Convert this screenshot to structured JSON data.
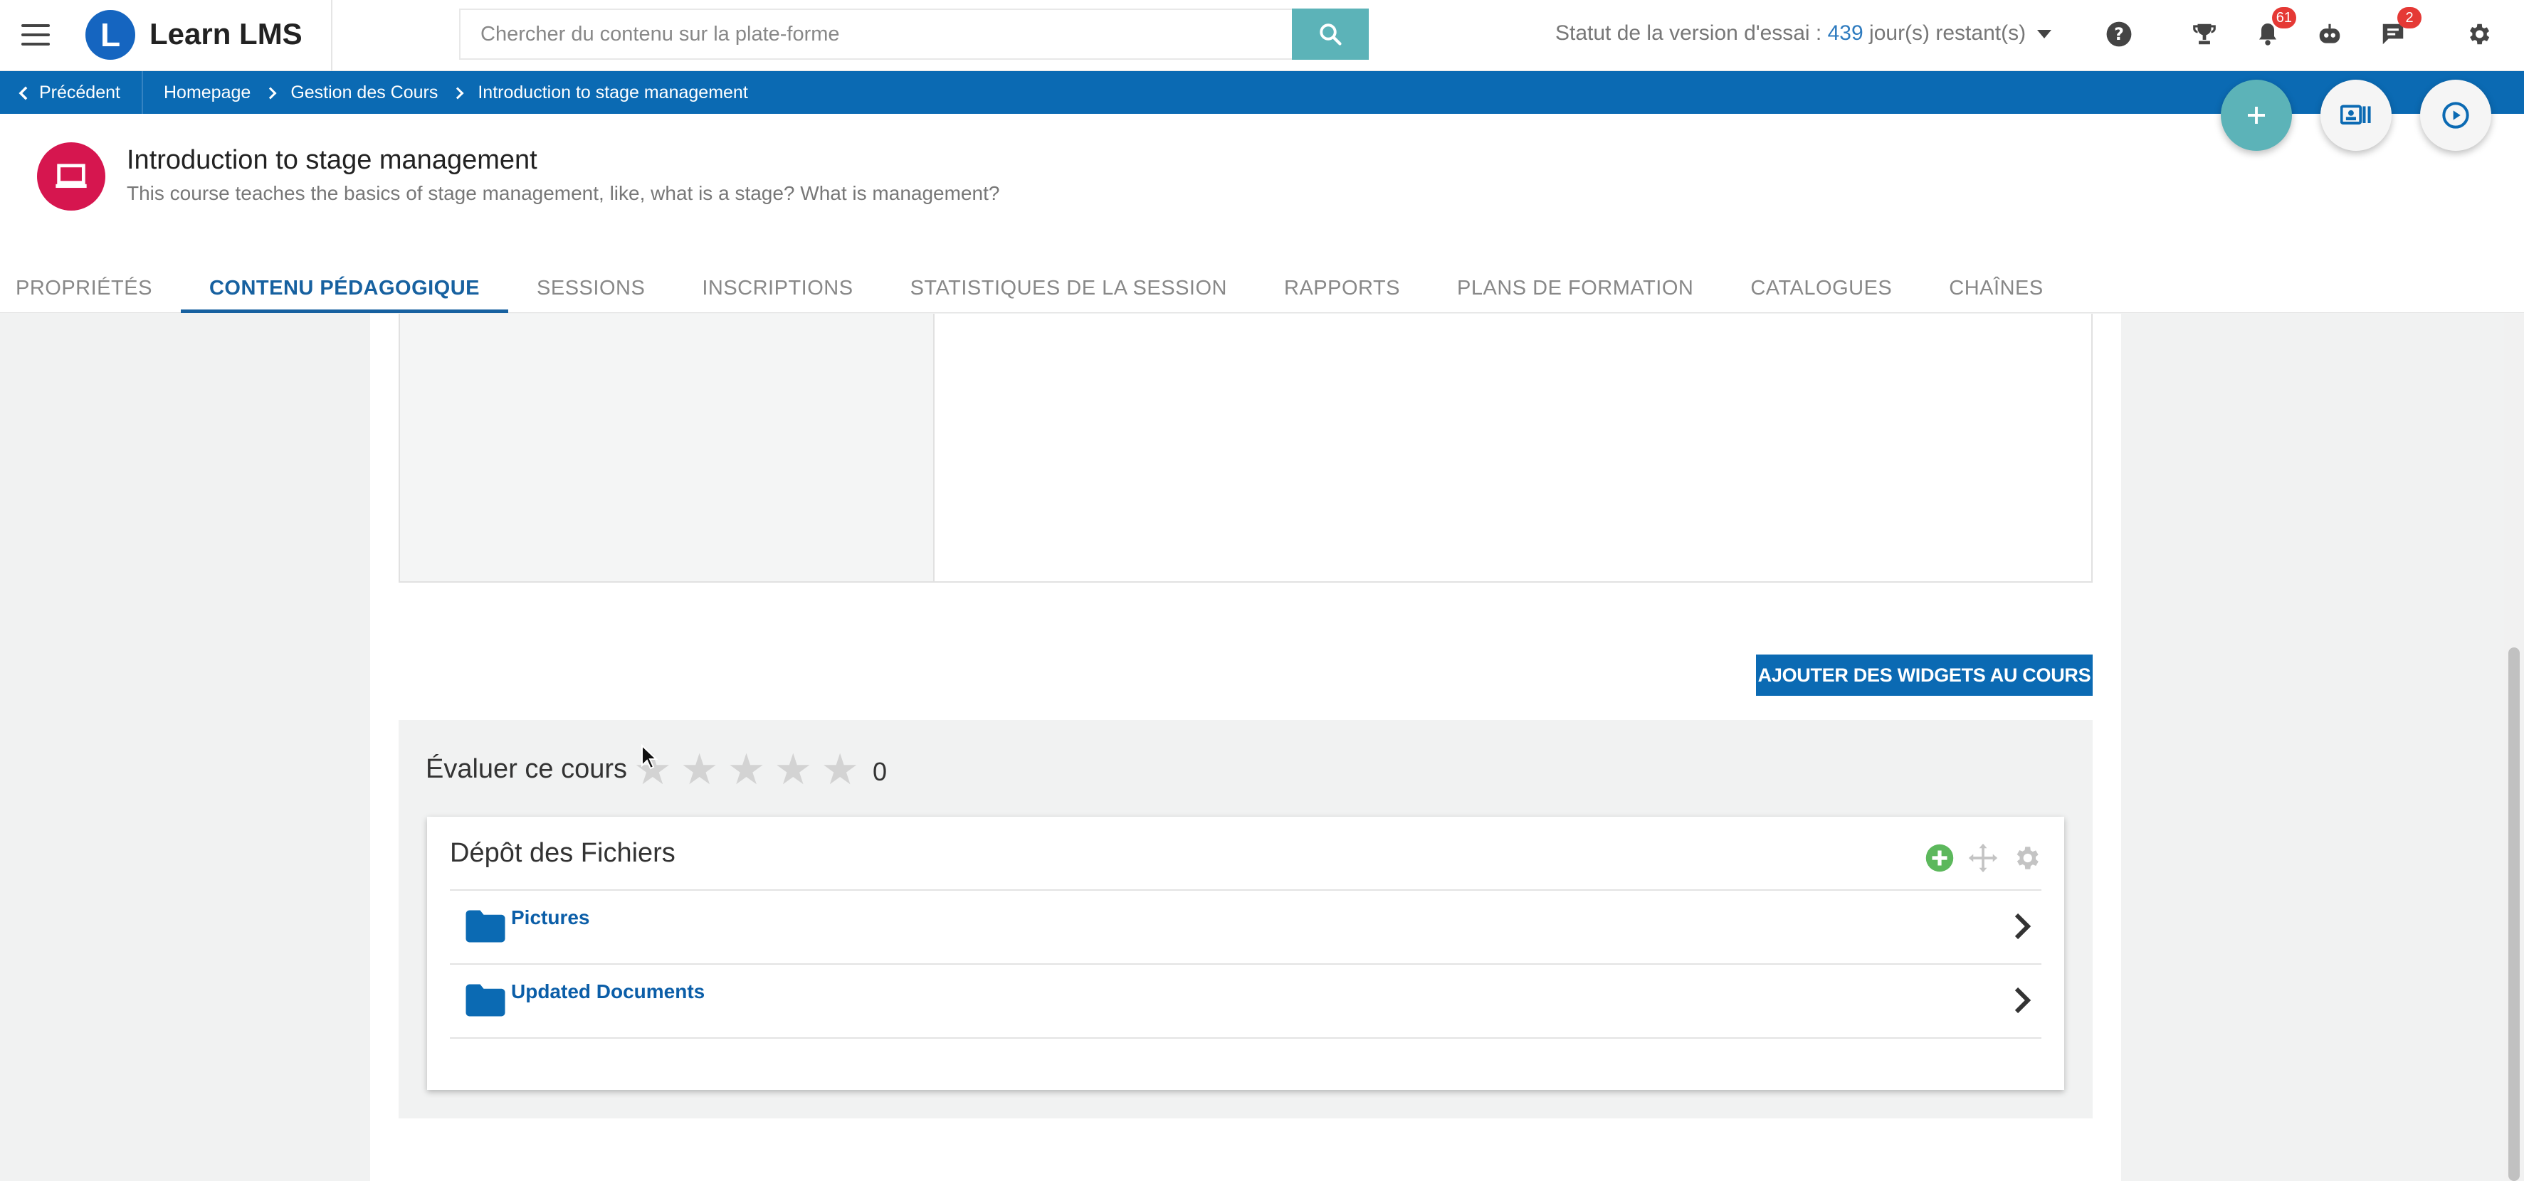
{
  "app": {
    "name": "Learn LMS",
    "logo_letter": "L"
  },
  "search": {
    "placeholder": "Chercher du contenu sur la plate-forme"
  },
  "trial": {
    "label": "Statut de la version d'essai :",
    "days": "439",
    "suffix": "jour(s) restant(s)"
  },
  "topbar": {
    "icons": [
      "menu-icon",
      "help-icon",
      "trophy-icon",
      "bell-icon",
      "bot-icon",
      "chat-icon",
      "gear-icon"
    ],
    "notifications_badge": "61",
    "messages_badge": "2"
  },
  "breadcrumb": {
    "back_label": "Précédent",
    "items": [
      "Homepage",
      "Gestion des Cours",
      "Introduction to stage management"
    ]
  },
  "course": {
    "title": "Introduction to stage management",
    "description": "This course teaches the basics of stage management, like, what is a stage? What is management?"
  },
  "tabs": [
    {
      "label": "PROPRIÉTÉS",
      "active": false
    },
    {
      "label": "CONTENU PÉDAGOGIQUE",
      "active": true
    },
    {
      "label": "SESSIONS",
      "active": false
    },
    {
      "label": "INSCRIPTIONS",
      "active": false
    },
    {
      "label": "STATISTIQUES DE LA SESSION",
      "active": false
    },
    {
      "label": "RAPPORTS",
      "active": false
    },
    {
      "label": "PLANS DE FORMATION",
      "active": false
    },
    {
      "label": "CATALOGUES",
      "active": false
    },
    {
      "label": "CHAÎNES",
      "active": false
    }
  ],
  "widgets": {
    "add_button": "AJOUTER DES WIDGETS AU COURS"
  },
  "rating": {
    "label": "Évaluer ce cours",
    "stars": 0,
    "max_stars": 5,
    "count": "0"
  },
  "files": {
    "title": "Dépôt des Fichiers",
    "folders": [
      "Pictures",
      "Updated Documents"
    ]
  },
  "colors": {
    "primary": "#0b6ab3",
    "accent": "#5cb3b8",
    "course_icon": "#d6164f",
    "badge": "#e53935"
  }
}
